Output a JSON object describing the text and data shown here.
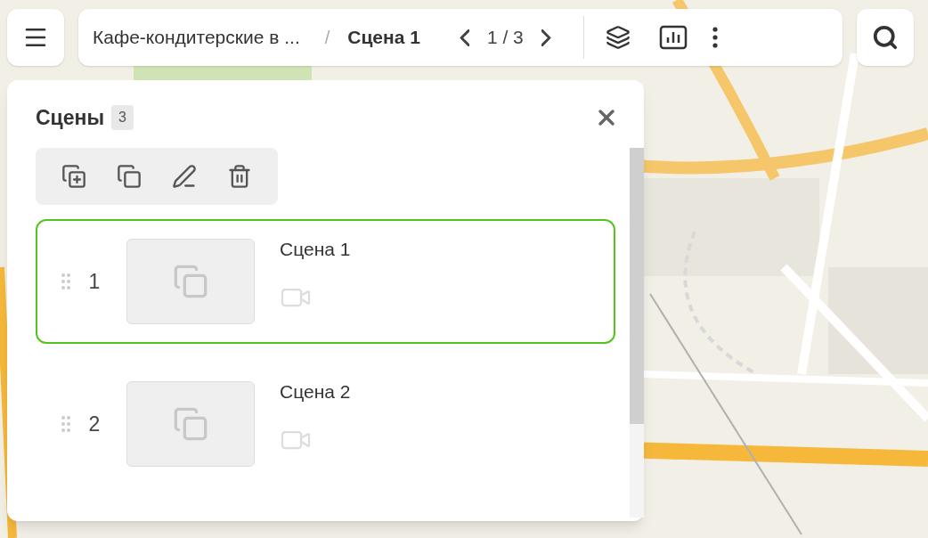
{
  "breadcrumb": {
    "title": "Кафе-кондитерские в ...",
    "separator": "/",
    "current": "Сцена 1",
    "pager": "1 / 3"
  },
  "panel": {
    "title": "Сцены",
    "count": "3",
    "scenes": [
      {
        "number": "1",
        "title": "Сцена 1",
        "selected": true
      },
      {
        "number": "2",
        "title": "Сцена 2",
        "selected": false
      }
    ]
  }
}
